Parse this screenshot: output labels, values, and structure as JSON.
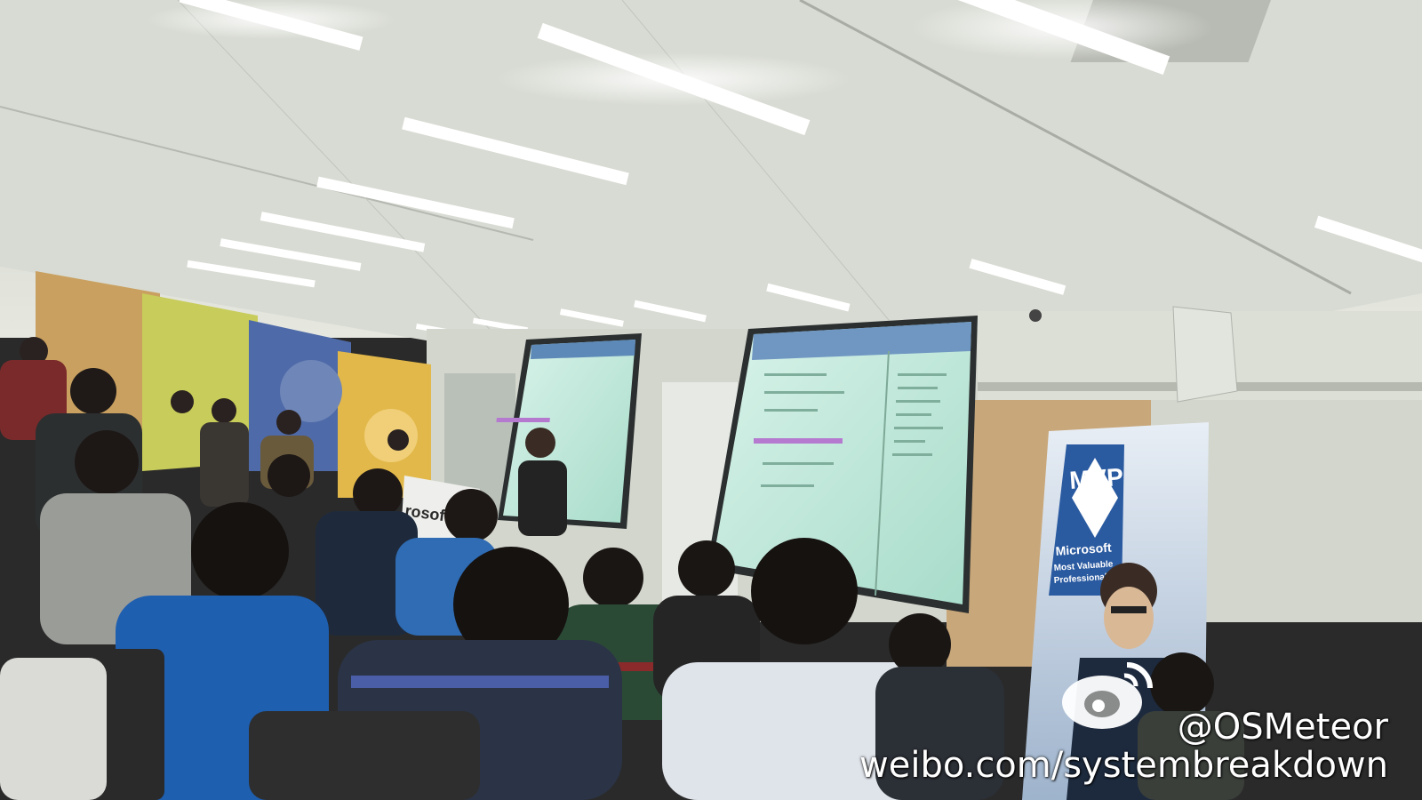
{
  "photo": {
    "banner": {
      "badge_text": "MVP",
      "brand": "Microsoft",
      "line1": "Most Valuable",
      "line2": "Professional"
    },
    "podium_text": "rosof"
  },
  "watermark": {
    "handle": "@OSMeteor",
    "url": "weibo.com/systembreakdown",
    "icon": "weibo-logo-icon"
  },
  "colors": {
    "ceiling": "#d9dcd4",
    "wall": "#cfd2c8",
    "screen": "#bfe6d8",
    "banner_blue": "#2a5aa0"
  }
}
